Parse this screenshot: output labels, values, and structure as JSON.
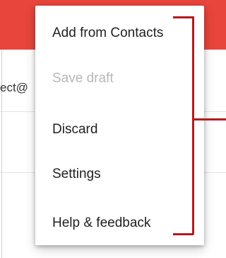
{
  "background_field": {
    "to_value": "ect@"
  },
  "menu": {
    "items": [
      {
        "label": "Add from Contacts",
        "enabled": true
      },
      {
        "label": "Save draft",
        "enabled": false
      },
      {
        "label": "Discard",
        "enabled": true
      },
      {
        "label": "Settings",
        "enabled": true
      },
      {
        "label": "Help & feedback",
        "enabled": true
      }
    ]
  },
  "colors": {
    "app_bar": "#e8453c",
    "annotation_bracket": "#b31b20",
    "disabled_text": "#b7b7b7"
  }
}
